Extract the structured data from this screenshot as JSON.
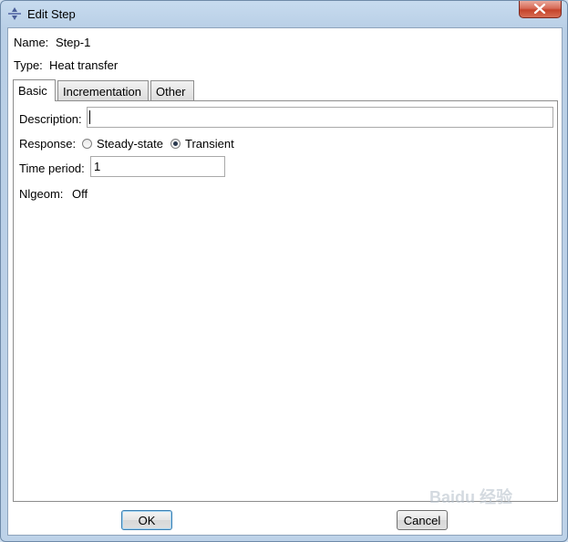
{
  "window": {
    "title": "Edit Step",
    "close_icon": "close-icon"
  },
  "info": {
    "name_label": "Name:",
    "name_value": "Step-1",
    "type_label": "Type:",
    "type_value": "Heat transfer"
  },
  "tabs": [
    {
      "label": "Basic",
      "active": true
    },
    {
      "label": "Incrementation",
      "active": false
    },
    {
      "label": "Other",
      "active": false
    }
  ],
  "basic": {
    "description_label": "Description:",
    "description_value": "",
    "response_label": "Response:",
    "response_options": [
      {
        "label": "Steady-state",
        "selected": false
      },
      {
        "label": "Transient",
        "selected": true
      }
    ],
    "time_period_label": "Time period:",
    "time_period_value": "1",
    "nlgeom_label": "Nlgeom:",
    "nlgeom_value": "Off"
  },
  "buttons": {
    "ok": "OK",
    "cancel": "Cancel"
  },
  "watermark": "Baidu 经验"
}
